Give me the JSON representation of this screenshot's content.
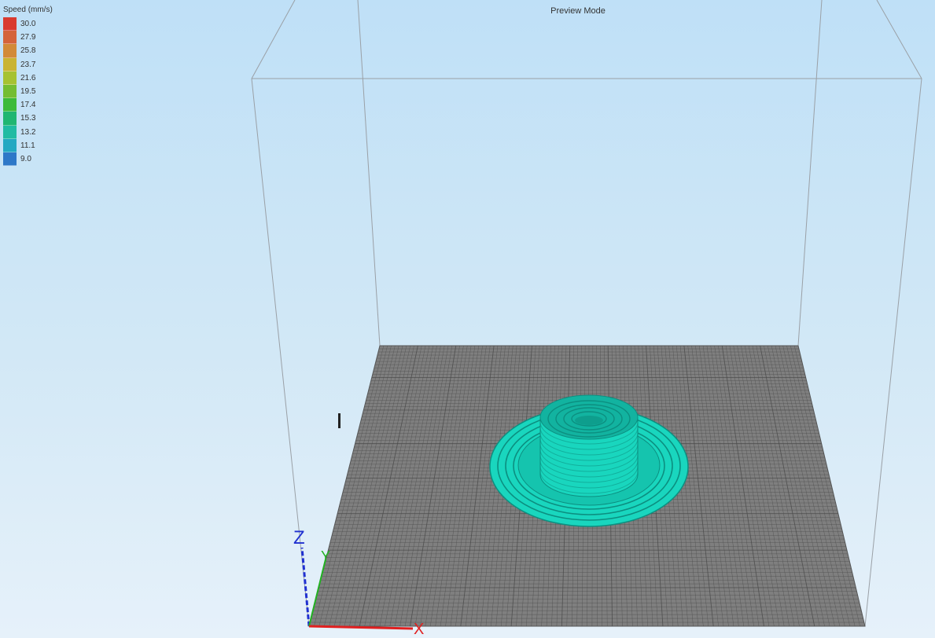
{
  "viewport": {
    "mode_label": "Preview Mode"
  },
  "legend": {
    "title": "Speed (mm/s)",
    "items": [
      {
        "label": "30.0",
        "color": "#d93a30"
      },
      {
        "label": "27.9",
        "color": "#d4633a"
      },
      {
        "label": "25.8",
        "color": "#d28a38"
      },
      {
        "label": "23.7",
        "color": "#c9b432"
      },
      {
        "label": "21.6",
        "color": "#a6c232"
      },
      {
        "label": "19.5",
        "color": "#74bd32"
      },
      {
        "label": "17.4",
        "color": "#3cba3a"
      },
      {
        "label": "15.3",
        "color": "#1fb672"
      },
      {
        "label": "13.2",
        "color": "#20bba3"
      },
      {
        "label": "11.1",
        "color": "#23a8c2"
      },
      {
        "label": "9.0",
        "color": "#2e78c8"
      }
    ]
  },
  "axes": {
    "x_label": "X",
    "y_label": "Y",
    "z_label": "Z",
    "x_color": "#e02020",
    "y_color": "#22b022",
    "z_color": "#2030d0"
  },
  "model": {
    "color": "#19d6be"
  },
  "bed": {
    "color": "#7f7f7f",
    "grid_color": "#4a4a4a"
  }
}
